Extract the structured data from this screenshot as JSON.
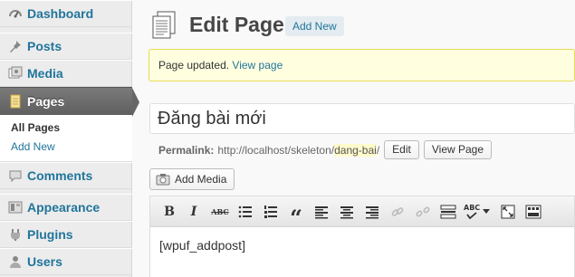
{
  "sidebar": {
    "items": [
      {
        "label": "Dashboard",
        "icon": "dashboard-icon"
      },
      {
        "label": "Posts",
        "icon": "pushpin-icon"
      },
      {
        "label": "Media",
        "icon": "media-icon"
      },
      {
        "label": "Pages",
        "icon": "pages-icon",
        "current": true
      },
      {
        "label": "Comments",
        "icon": "comment-icon"
      },
      {
        "label": "Appearance",
        "icon": "appearance-icon"
      },
      {
        "label": "Plugins",
        "icon": "plugin-icon"
      },
      {
        "label": "Users",
        "icon": "users-icon"
      }
    ],
    "submenu": {
      "all_pages": "All Pages",
      "add_new": "Add New"
    }
  },
  "header": {
    "title": "Edit Page",
    "add_new": "Add New"
  },
  "notice": {
    "text": "Page updated.",
    "link": "View page"
  },
  "post": {
    "title": "Đăng bài mới",
    "content": "[wpuf_addpost]"
  },
  "permalink": {
    "label": "Permalink:",
    "base": "http://localhost/skeleton/",
    "slug": "dang-bai",
    "trail": "/",
    "edit": "Edit",
    "view": "View Page"
  },
  "media": {
    "add_media": "Add Media"
  },
  "toolbar": {
    "buttons": [
      "bold-icon",
      "italic-icon",
      "strikethrough-icon",
      "bullet-list-icon",
      "numbered-list-icon",
      "blockquote-icon",
      "align-left-icon",
      "align-center-icon",
      "align-right-icon",
      "link-icon",
      "unlink-icon",
      "more-tag-icon",
      "spellcheck-icon",
      "fullscreen-icon",
      "kitchen-sink-icon"
    ],
    "bold": "B",
    "italic": "I",
    "strike": "ABC",
    "quote": "“",
    "spell": "ABC"
  },
  "colors": {
    "link": "#21759b",
    "notice_bg": "#ffffe0",
    "notice_border": "#e6db55",
    "current_menu": "#6b6b6b"
  }
}
